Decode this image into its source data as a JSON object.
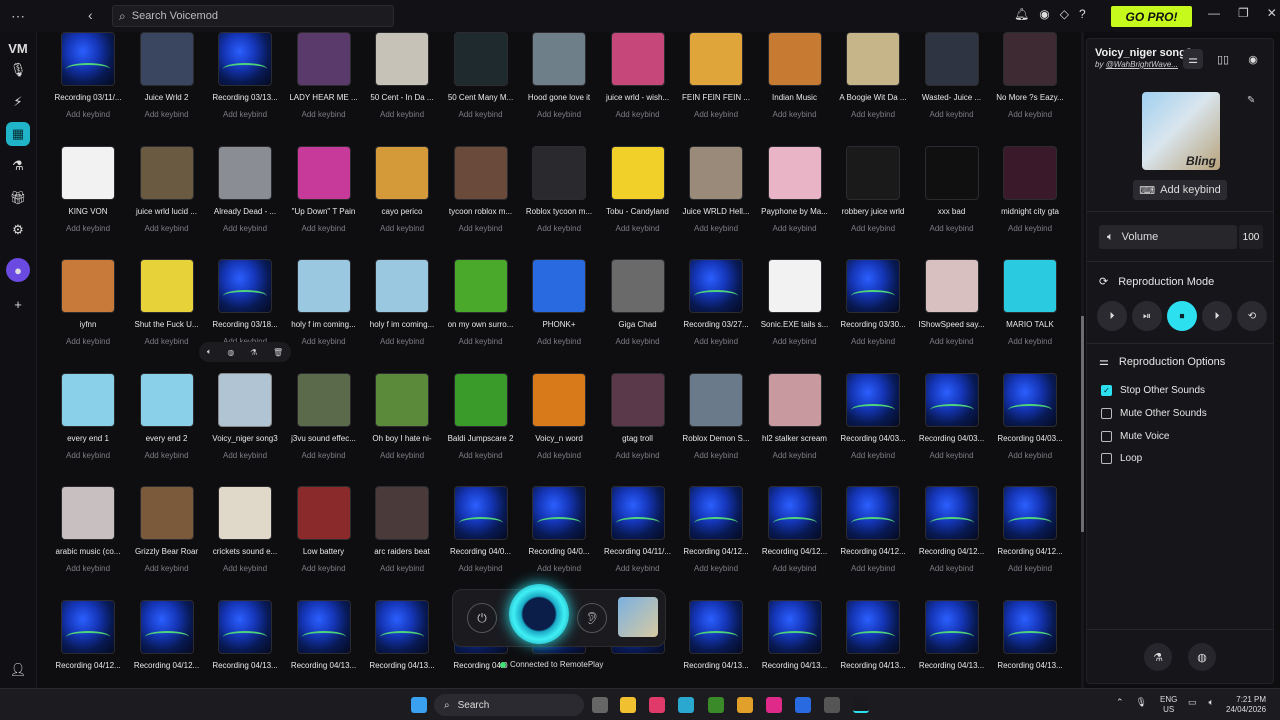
{
  "search": {
    "placeholder": "Search Voicemod"
  },
  "header": {
    "go_pro": "GO PRO!"
  },
  "sounds": [
    {
      "name": "Recording 03/11/...",
      "key": "Add keybind",
      "thumb": "wave"
    },
    {
      "name": "Juice Wrld 2",
      "key": "Add keybind",
      "thumb": "#3a4660"
    },
    {
      "name": "Recording 03/13...",
      "key": "Add keybind",
      "thumb": "wave"
    },
    {
      "name": "LADY HEAR ME ...",
      "key": "Add keybind",
      "thumb": "#5a3a6a"
    },
    {
      "name": "50 Cent - In Da ...",
      "key": "Add keybind",
      "thumb": "#c7c2b8"
    },
    {
      "name": "50 Cent Many M...",
      "key": "Add keybind",
      "thumb": "#1f2a2e"
    },
    {
      "name": "Hood gone love it",
      "key": "Add keybind",
      "thumb": "#6f7f8a"
    },
    {
      "name": "juice wrld - wish...",
      "key": "Add keybind",
      "thumb": "#c6477a"
    },
    {
      "name": "FEIN FEIN FEIN ...",
      "key": "Add keybind",
      "thumb": "#e0a53a"
    },
    {
      "name": "Indian Music",
      "key": "Add keybind",
      "thumb": "#c77a32"
    },
    {
      "name": "A Boogie Wit Da ...",
      "key": "Add keybind",
      "thumb": "#c7b58a"
    },
    {
      "name": "Wasted- Juice ...",
      "key": "Add keybind",
      "thumb": "#2e3442"
    },
    {
      "name": "No More ?s Eazy...",
      "key": "Add keybind",
      "thumb": "#3e2a32"
    },
    {
      "name": "KING VON",
      "key": "Add keybind",
      "thumb": "#f2f2f2"
    },
    {
      "name": "juice wrld lucid ...",
      "key": "Add keybind",
      "thumb": "#6a5a42"
    },
    {
      "name": "Already Dead - ...",
      "key": "Add keybind",
      "thumb": "#8a8e94"
    },
    {
      "name": "\"Up Down\" T Pain",
      "key": "Add keybind",
      "thumb": "#c83a9a"
    },
    {
      "name": "cayo perico",
      "key": "Add keybind",
      "thumb": "#d49a3a"
    },
    {
      "name": "tycoon roblox m...",
      "key": "Add keybind",
      "thumb": "#6a4a3a"
    },
    {
      "name": "Roblox tycoon m...",
      "key": "Add keybind",
      "thumb": "#2a2a2e"
    },
    {
      "name": "Tobu - Candyland",
      "key": "Add keybind",
      "thumb": "#f2d02a"
    },
    {
      "name": "Juice WRLD Hell...",
      "key": "Add keybind",
      "thumb": "#9a8a7a"
    },
    {
      "name": "Payphone by Ma...",
      "key": "Add keybind",
      "thumb": "#e8b4c6"
    },
    {
      "name": "robbery juice wrld",
      "key": "Add keybind",
      "thumb": "#1a1a1a"
    },
    {
      "name": "xxx bad",
      "key": "Add keybind",
      "thumb": "#101010"
    },
    {
      "name": "midnight city gta",
      "key": "Add keybind",
      "thumb": "#3a1a2a"
    },
    {
      "name": "iyfnn",
      "key": "Add keybind",
      "thumb": "#c87a3a"
    },
    {
      "name": "Shut the Fuck U...",
      "key": "Add keybind",
      "thumb": "#e8d23a"
    },
    {
      "name": "Recording 03/18...",
      "key": "Add keybind",
      "thumb": "wave"
    },
    {
      "name": "holy f im coming...",
      "key": "Add keybind",
      "thumb": "#9ac8e0"
    },
    {
      "name": "holy f im coming...",
      "key": "Add keybind",
      "thumb": "#9ac8e0"
    },
    {
      "name": "on my own surro...",
      "key": "Add keybind",
      "thumb": "#4aa82a"
    },
    {
      "name": "PHONK+",
      "key": "Add keybind",
      "thumb": "#2a6ae0"
    },
    {
      "name": "Giga Chad",
      "key": "Add keybind",
      "thumb": "#6a6a6a"
    },
    {
      "name": "Recording 03/27...",
      "key": "Add keybind",
      "thumb": "wave"
    },
    {
      "name": "Sonic.EXE tails s...",
      "key": "Add keybind",
      "thumb": "#f2f2f2"
    },
    {
      "name": "Recording 03/30...",
      "key": "Add keybind",
      "thumb": "wave"
    },
    {
      "name": "IShowSpeed say...",
      "key": "Add keybind",
      "thumb": "#d8c0c0"
    },
    {
      "name": "MARIO TALK",
      "key": "Add keybind",
      "thumb": "#2acbe0"
    },
    {
      "name": "every end 1",
      "key": "Add keybind",
      "thumb": "#8ad0e8"
    },
    {
      "name": "every end 2",
      "key": "Add keybind",
      "thumb": "#8ad0e8"
    },
    {
      "name": "Voicy_niger song3",
      "key": "Add keybind",
      "thumb": "#b0c4d4"
    },
    {
      "name": "j3vu sound effec...",
      "key": "Add keybind",
      "thumb": "#5a6a4a"
    },
    {
      "name": "Oh boy I hate ni-",
      "key": "Add keybind",
      "thumb": "#5a8a3a"
    },
    {
      "name": "Baldi Jumpscare 2",
      "key": "Add keybind",
      "thumb": "#3a9a2a"
    },
    {
      "name": "Voicy_n word",
      "key": "Add keybind",
      "thumb": "#d87a1a"
    },
    {
      "name": "gtag troll",
      "key": "Add keybind",
      "thumb": "#5a3a4a"
    },
    {
      "name": "Roblox Demon S...",
      "key": "Add keybind",
      "thumb": "#6a7a8a"
    },
    {
      "name": "hl2 stalker scream",
      "key": "Add keybind",
      "thumb": "#c89aa0"
    },
    {
      "name": "Recording 04/03...",
      "key": "Add keybind",
      "thumb": "wave"
    },
    {
      "name": "Recording 04/03...",
      "key": "Add keybind",
      "thumb": "wave"
    },
    {
      "name": "Recording 04/03...",
      "key": "Add keybind",
      "thumb": "wave"
    },
    {
      "name": "arabic music (co...",
      "key": "Add keybind",
      "thumb": "#c8c0c0"
    },
    {
      "name": "Grizzly Bear Roar",
      "key": "Add keybind",
      "thumb": "#7a5a3a"
    },
    {
      "name": "crickets sound e...",
      "key": "Add keybind",
      "thumb": "#e0d8c8"
    },
    {
      "name": "Low battery",
      "key": "Add keybind",
      "thumb": "#8a2a2a"
    },
    {
      "name": "arc raiders beat",
      "key": "Add keybind",
      "thumb": "#4a3a3a"
    },
    {
      "name": "Recording 04/0...",
      "key": "Add keybind",
      "thumb": "wave"
    },
    {
      "name": "Recording 04/0...",
      "key": "Add keybind",
      "thumb": "wave"
    },
    {
      "name": "Recording 04/11/...",
      "key": "Add keybind",
      "thumb": "wave"
    },
    {
      "name": "Recording 04/12...",
      "key": "Add keybind",
      "thumb": "wave"
    },
    {
      "name": "Recording 04/12...",
      "key": "Add keybind",
      "thumb": "wave"
    },
    {
      "name": "Recording 04/12...",
      "key": "Add keybind",
      "thumb": "wave"
    },
    {
      "name": "Recording 04/12...",
      "key": "Add keybind",
      "thumb": "wave"
    },
    {
      "name": "Recording 04/12...",
      "key": "Add keybind",
      "thumb": "wave"
    },
    {
      "name": "Recording 04/12...",
      "key": "",
      "thumb": "wave"
    },
    {
      "name": "Recording 04/12...",
      "key": "",
      "thumb": "wave"
    },
    {
      "name": "Recording 04/13...",
      "key": "",
      "thumb": "wave"
    },
    {
      "name": "Recording 04/13...",
      "key": "",
      "thumb": "wave"
    },
    {
      "name": "Recording 04/13...",
      "key": "",
      "thumb": "wave"
    },
    {
      "name": "Recording 04/0",
      "key": "",
      "thumb": "wave"
    },
    {
      "name": "",
      "key": "",
      "thumb": "wave"
    },
    {
      "name": "",
      "key": "",
      "thumb": "wave"
    },
    {
      "name": "Recording 04/13...",
      "key": "",
      "thumb": "wave"
    },
    {
      "name": "Recording 04/13...",
      "key": "",
      "thumb": "wave"
    },
    {
      "name": "Recording 04/13...",
      "key": "",
      "thumb": "wave"
    },
    {
      "name": "Recording 04/13...",
      "key": "",
      "thumb": "wave"
    },
    {
      "name": "Recording 04/13...",
      "key": "",
      "thumb": "wave"
    }
  ],
  "player": {
    "status": "Connected to RemotePlay"
  },
  "panel": {
    "title": "Voicy_niger song3",
    "by_prefix": "by",
    "author": "@WahBrightWave...",
    "add_keybind": "Add keybind",
    "volume_label": "Volume",
    "volume_value": "100",
    "repro_mode_title": "Reproduction Mode",
    "repro_options_title": "Reproduction Options",
    "options": [
      {
        "label": "Stop Other Sounds",
        "checked": true
      },
      {
        "label": "Mute Other Sounds",
        "checked": false
      },
      {
        "label": "Mute Voice",
        "checked": false
      },
      {
        "label": "Loop",
        "checked": false
      }
    ]
  },
  "taskbar": {
    "search_label": "Search",
    "lang_top": "ENG",
    "lang_bottom": "US",
    "time": "7:21 PM",
    "date": "24/04/2026"
  },
  "colors": {
    "accent": "#2de0f0",
    "gopro": "#c6f91c"
  }
}
